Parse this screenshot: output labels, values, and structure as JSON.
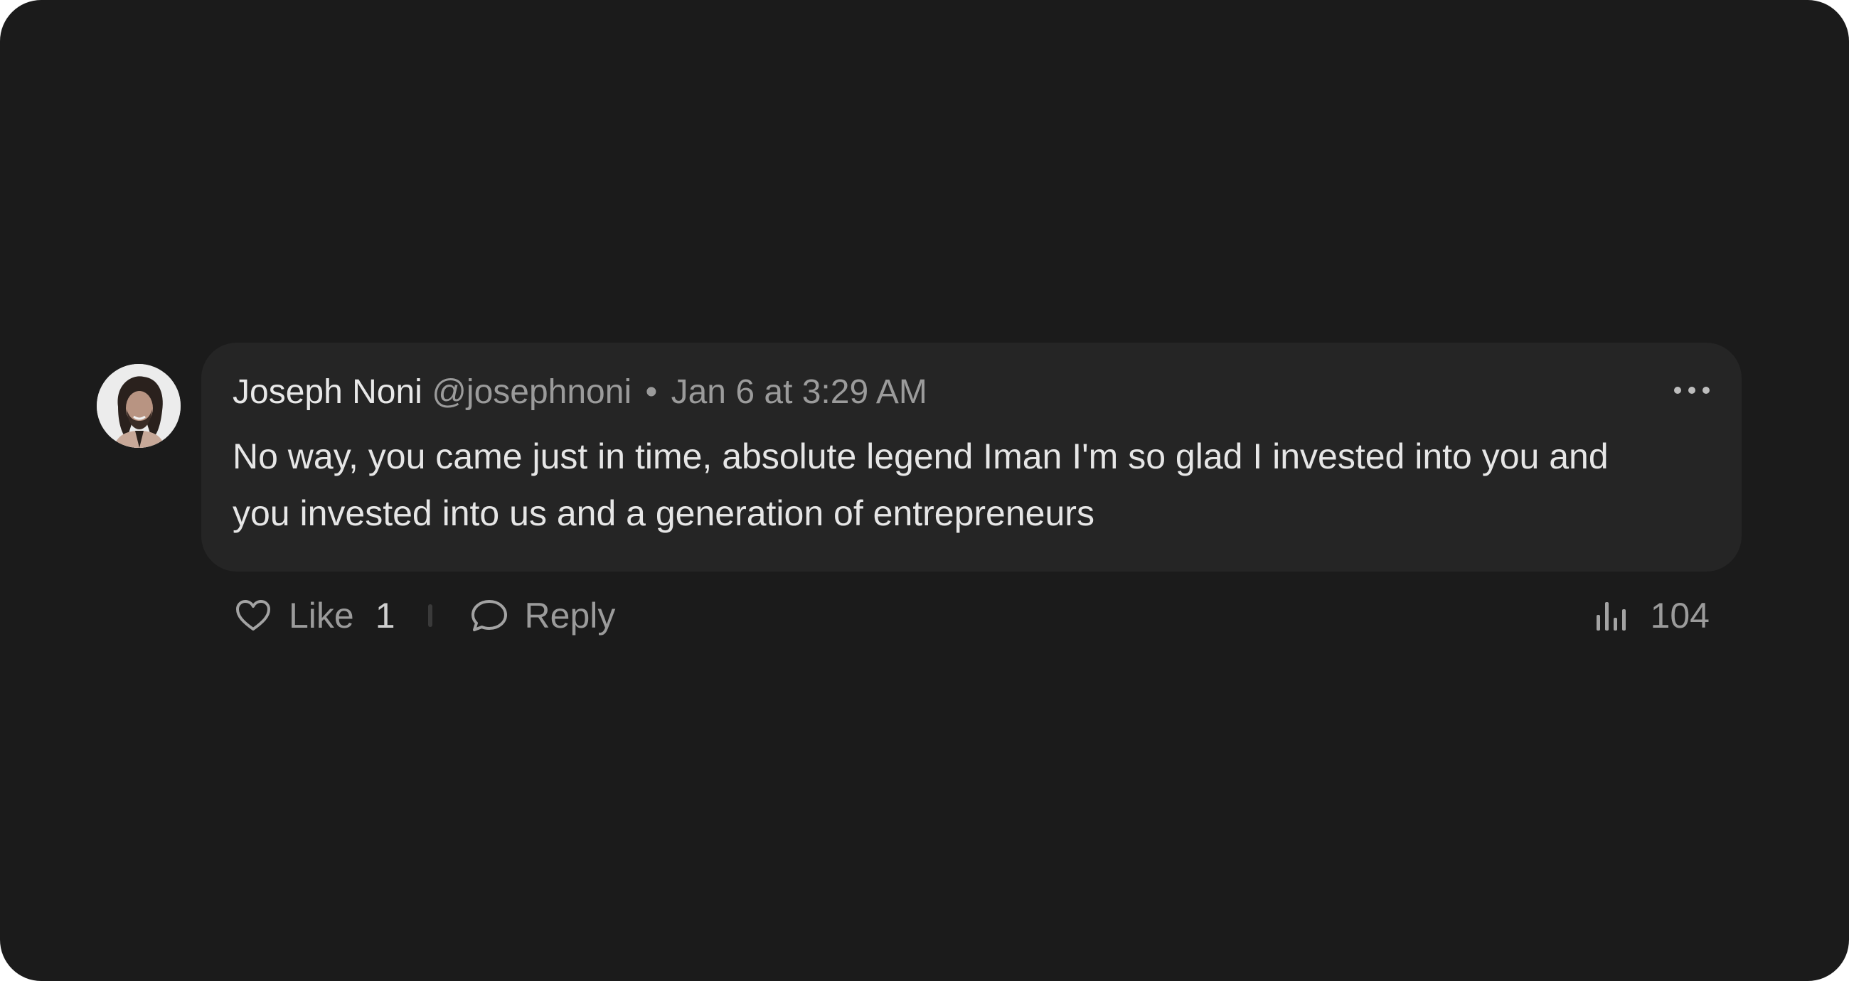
{
  "comment": {
    "author_name": "Joseph Noni",
    "author_handle": "@josephnoni",
    "separator": "•",
    "timestamp": "Jan 6 at 3:29 AM",
    "text": "No way, you came just in time, absolute legend Iman I'm so glad I invested into you and you invested into us and a generation of entrepreneurs"
  },
  "actions": {
    "like_label": "Like",
    "like_count": "1",
    "reply_label": "Reply",
    "views_count": "104"
  },
  "icons": {
    "avatar": "user-avatar",
    "more": "more-horizontal-icon",
    "like": "heart-icon",
    "reply": "speech-bubble-icon",
    "views": "bar-chart-icon"
  },
  "colors": {
    "background": "#1b1b1b",
    "bubble": "#252525",
    "primary_text": "#e6e6e6",
    "secondary_text": "#9b9b9b"
  }
}
